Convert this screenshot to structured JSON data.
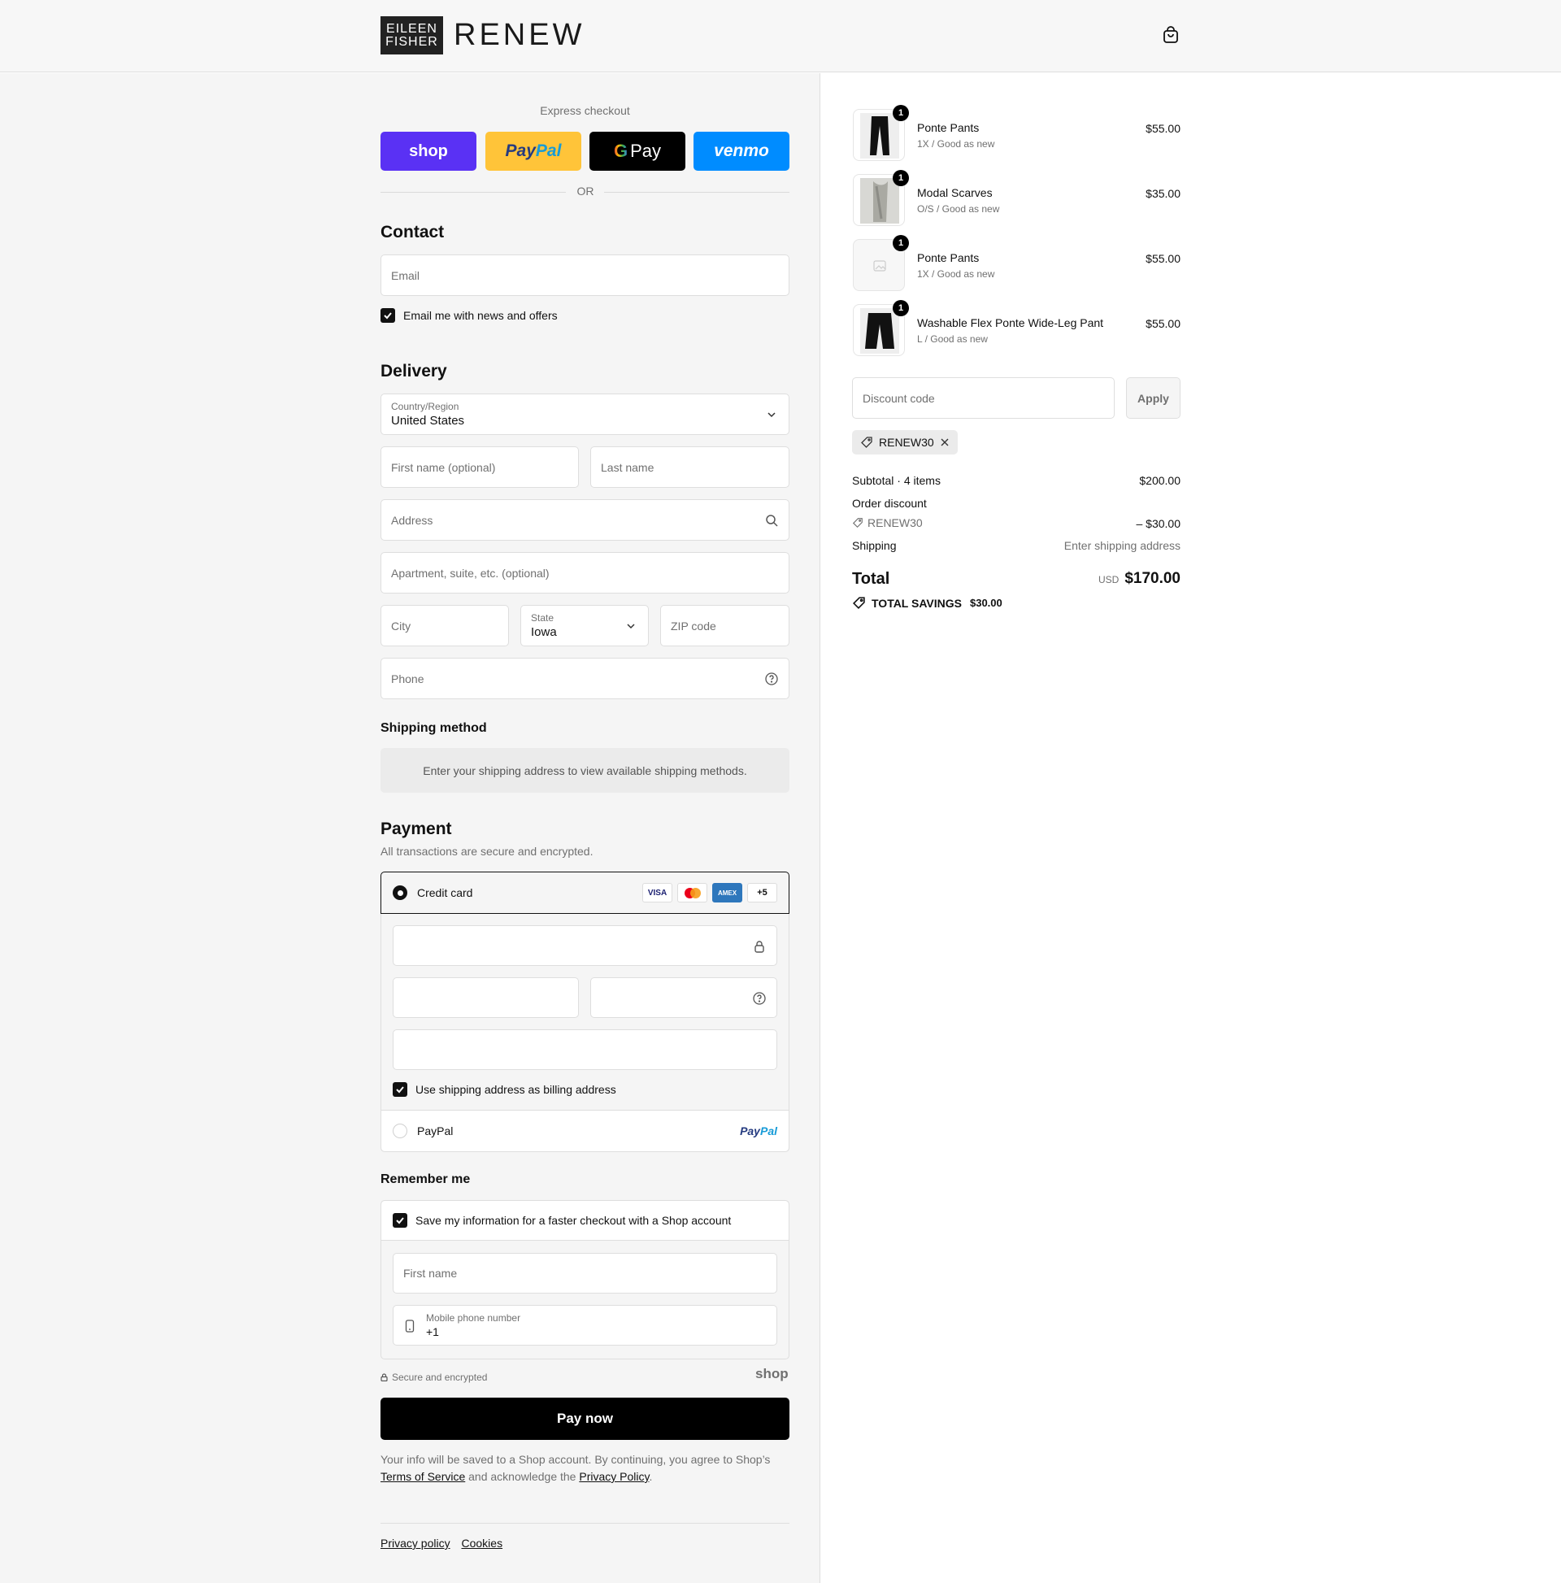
{
  "header": {
    "logo_line1": "EILEEN",
    "logo_line2": "FISHER",
    "logo_word": "RENEW"
  },
  "express": {
    "title": "Express checkout",
    "shop_label": "shop",
    "paypal_label1": "Pay",
    "paypal_label2": "Pal",
    "gpay_label": "Pay",
    "venmo_label": "venmo",
    "or": "OR"
  },
  "contact": {
    "title": "Contact",
    "email_placeholder": "Email",
    "news_label": "Email me with news and offers"
  },
  "delivery": {
    "title": "Delivery",
    "country_label": "Country/Region",
    "country_value": "United States",
    "first_name": "First name (optional)",
    "last_name": "Last name",
    "address": "Address",
    "apartment": "Apartment, suite, etc. (optional)",
    "city": "City",
    "state_label": "State",
    "state_value": "Iowa",
    "zip": "ZIP code",
    "phone": "Phone"
  },
  "shipping_method": {
    "title": "Shipping method",
    "info": "Enter your shipping address to view available shipping methods."
  },
  "payment": {
    "title": "Payment",
    "subtitle": "All transactions are secure and encrypted.",
    "credit_card": "Credit card",
    "visa": "VISA",
    "amex": "AMEX",
    "more": "+5",
    "billing_label": "Use shipping address as billing address",
    "paypal_option": "PayPal",
    "paypal_logo1": "Pay",
    "paypal_logo2": "Pal"
  },
  "remember": {
    "title": "Remember me",
    "save_label": "Save my information for a faster checkout with a Shop account",
    "first_name": "First name",
    "mobile_label": "Mobile phone number",
    "mobile_value": "+1",
    "secure": "Secure and encrypted",
    "shop_logo": "shop"
  },
  "pay_now": "Pay now",
  "terms": {
    "text1": "Your info will be saved to a Shop account. By continuing, you agree to Shop’s",
    "tos": "Terms of Service",
    "text2": "and acknowledge the",
    "privacy": "Privacy Policy",
    "text3": "."
  },
  "footer": {
    "privacy": "Privacy policy",
    "cookies": "Cookies"
  },
  "cart": {
    "items": [
      {
        "name": "Ponte Pants",
        "variant": "1X / Good as new",
        "price": "$55.00",
        "qty": "1"
      },
      {
        "name": "Modal Scarves",
        "variant": "O/S / Good as new",
        "price": "$35.00",
        "qty": "1"
      },
      {
        "name": "Ponte Pants",
        "variant": "1X / Good as new",
        "price": "$55.00",
        "qty": "1"
      },
      {
        "name": "Washable Flex Ponte Wide-Leg Pant",
        "variant": "L / Good as new",
        "price": "$55.00",
        "qty": "1"
      }
    ],
    "discount_placeholder": "Discount code",
    "apply": "Apply",
    "tag": "RENEW30",
    "subtotal_label": "Subtotal · 4 items",
    "subtotal": "$200.00",
    "order_discount": "Order discount",
    "discount_code": "RENEW30",
    "discount_amount": "– $30.00",
    "shipping_label": "Shipping",
    "shipping_value": "Enter shipping address",
    "total_label": "Total",
    "currency": "USD",
    "total": "$170.00",
    "savings_label": "TOTAL SAVINGS",
    "savings": "$30.00"
  }
}
